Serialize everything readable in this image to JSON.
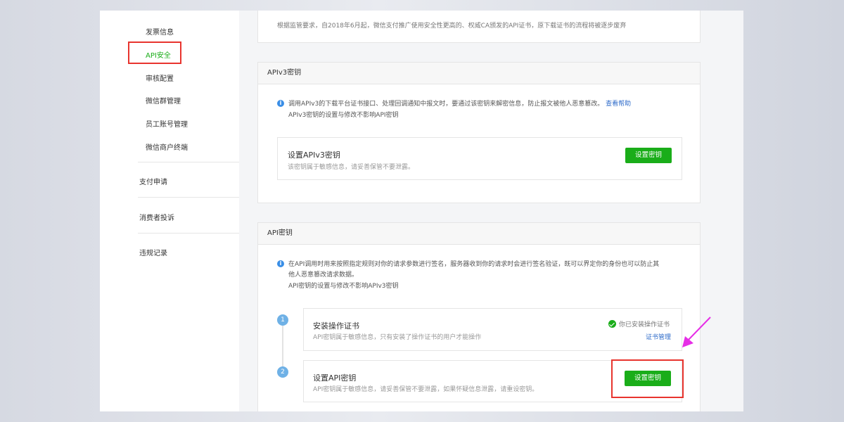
{
  "sidebar": {
    "items": [
      {
        "label": "发票信息"
      },
      {
        "label": "API安全",
        "active": true
      },
      {
        "label": "审核配置"
      },
      {
        "label": "微信群管理"
      },
      {
        "label": "员工账号管理"
      },
      {
        "label": "微信商户终端"
      }
    ],
    "groups": [
      {
        "label": "支付申请"
      },
      {
        "label": "消费者投诉"
      },
      {
        "label": "违规记录"
      }
    ]
  },
  "top_notice": "根据监管要求，自2018年6月起，微信支付推广使用安全性更高的、权威CA颁发的API证书，原下载证书的流程将被逐步废弃",
  "apiv3": {
    "header": "APIv3密钥",
    "notice_line1": "调用APIv3的下载平台证书接口、处理回调通知中报文时，要通过该密钥来解密信息，防止报文被他人恶意篡改。",
    "help_link": "查看帮助",
    "notice_line2": "APIv3密钥的设置与修改不影响API密钥",
    "box_title": "设置APIv3密钥",
    "box_sub": "该密钥属于敏感信息，请妥善保管不要泄露。",
    "button": "设置密钥"
  },
  "api": {
    "header": "API密钥",
    "notice_line1": "在API调用时用来按照指定规则对你的请求参数进行签名，服务器收到你的请求时会进行签名验证，既可以界定你的身份也可以防止其",
    "notice_line2": "他人恶意篡改请求数据。",
    "notice_line3": "API密钥的设置与修改不影响APIv3密钥",
    "steps": [
      {
        "num": "1",
        "title": "安装操作证书",
        "sub": "API密钥属于敏感信息，只有安装了操作证书的用户才能操作",
        "status": "你已安装操作证书",
        "link": "证书管理"
      },
      {
        "num": "2",
        "title": "设置API密钥",
        "sub": "API密钥属于敏感信息，请妥善保管不要泄露，如果怀疑信息泄露，请重设密钥。",
        "button": "设置密钥"
      }
    ]
  },
  "colors": {
    "accent_green": "#1aad19",
    "highlight_red": "#e8342e",
    "link_blue": "#2e6bc9",
    "arrow_magenta": "#e62ee6"
  }
}
